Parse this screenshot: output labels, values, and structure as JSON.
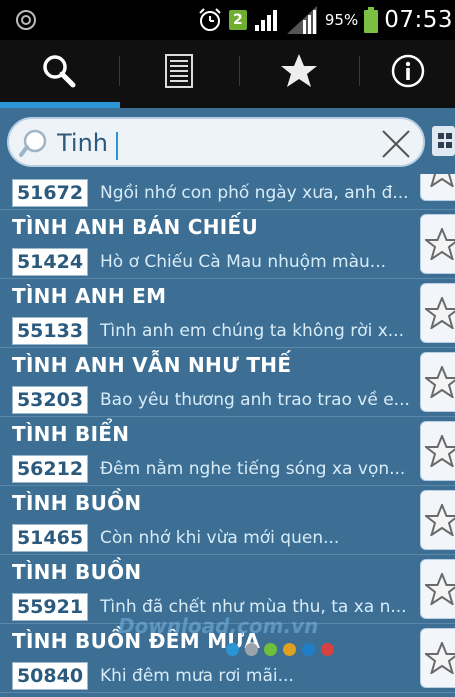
{
  "status_bar": {
    "sim_slot": "2",
    "battery": "95%",
    "time": "07:53"
  },
  "tabs": [
    {
      "name": "search",
      "icon": "search-icon",
      "active": true
    },
    {
      "name": "list",
      "icon": "list-icon",
      "active": false
    },
    {
      "name": "favorites",
      "icon": "star-icon",
      "active": false
    },
    {
      "name": "info",
      "icon": "info-icon",
      "active": false
    }
  ],
  "search": {
    "value": "Tinh"
  },
  "colors": {
    "background": "#3d6f95",
    "tab_indicator": "#2b95d6",
    "code_text": "#2c5a7d",
    "lyric_text": "#d8ecf8"
  },
  "songs": [
    {
      "title": "",
      "code": "51672",
      "lyric": "Ngồi nhớ con phố ngày xưa, anh đ..."
    },
    {
      "title": "TÌNH ANH BÁN CHIẾU",
      "code": "51424",
      "lyric": "Hò ơ Chiếu Cà Mau nhuộm màu..."
    },
    {
      "title": "TÌNH ANH EM",
      "code": "55133",
      "lyric": "Tình anh em chúng ta không rời x..."
    },
    {
      "title": "TÌNH ANH VẪN NHƯ THẾ",
      "code": "53203",
      "lyric": "Bao yêu thương anh trao trao về e..."
    },
    {
      "title": "TÌNH BIỂN",
      "code": "56212",
      "lyric": "Đêm nằm nghe tiếng sóng xa vọn..."
    },
    {
      "title": "TÌNH BUỒN",
      "code": "51465",
      "lyric": "Còn nhớ khi vừa mới quen..."
    },
    {
      "title": "TÌNH BUỒN",
      "code": "55921",
      "lyric": "Tình đã chết như mùa thu, ta xa n..."
    },
    {
      "title": "TÌNH BUỒN ĐÊM MƯA",
      "code": "50840",
      "lyric": "Khi đêm mưa rơi mãi..."
    }
  ],
  "watermark": {
    "text": "Download.com.vn",
    "dot_colors": [
      "#2b95d6",
      "#9aa3ab",
      "#6fbf3a",
      "#e0a020",
      "#1e7fc8",
      "#d94040"
    ]
  }
}
